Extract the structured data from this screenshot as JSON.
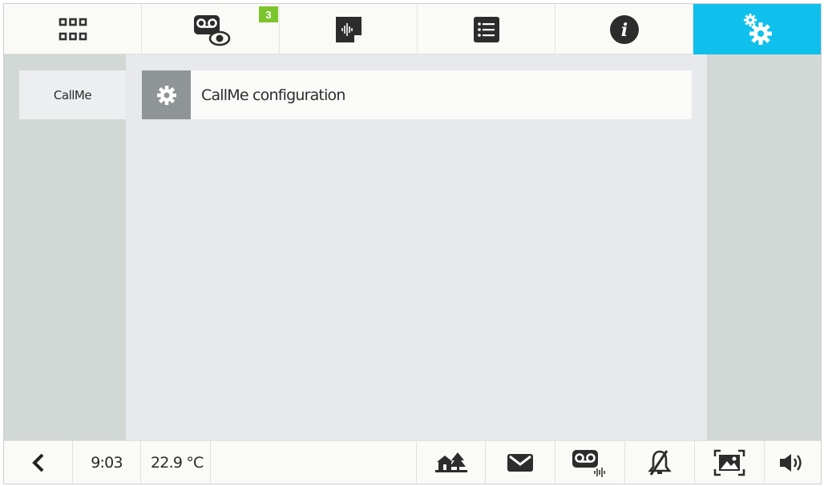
{
  "tabs": [
    {
      "name": "apps",
      "icon": "grid-icon",
      "active": false
    },
    {
      "name": "recordings",
      "icon": "voicemail-eye-icon",
      "active": false,
      "badge": "3"
    },
    {
      "name": "audio-notes",
      "icon": "audio-note-icon",
      "active": false
    },
    {
      "name": "list",
      "icon": "list-icon",
      "active": false
    },
    {
      "name": "info",
      "icon": "info-icon",
      "active": false
    },
    {
      "name": "settings",
      "icon": "gears-icon",
      "active": true
    }
  ],
  "sidebar": {
    "items": [
      {
        "label": "CallMe"
      }
    ]
  },
  "main": {
    "items": [
      {
        "label": "CallMe configuration",
        "icon": "gear-icon"
      }
    ]
  },
  "statusbar": {
    "time": "9:03",
    "temperature": "22.9 °C"
  },
  "colors": {
    "accent": "#10c0ec",
    "badge": "#7cc42c",
    "panel": "#d2d8d6",
    "content": "#e7e9ed"
  }
}
